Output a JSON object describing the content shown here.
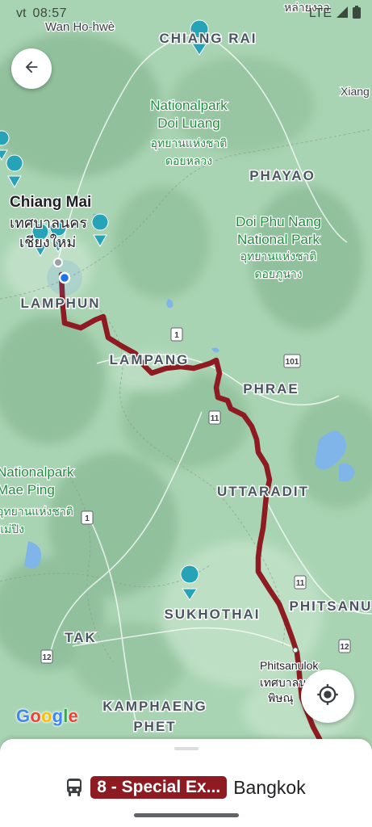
{
  "status_bar": {
    "time": "08:57",
    "carrier_fragment": "vt",
    "network": "LTE",
    "icons": [
      "cell-signal-icon",
      "battery-icon"
    ]
  },
  "map": {
    "cities": [
      {
        "name": "CHIANG RAI"
      },
      {
        "name": "PHAYAO"
      },
      {
        "name": "LAMPHUN"
      },
      {
        "name": "LAMPANG"
      },
      {
        "name": "PHRAE"
      },
      {
        "name": "UTTARADIT"
      },
      {
        "name": "SUKHOTHAI"
      },
      {
        "name": "TAK"
      },
      {
        "name": "KAMPHAENG"
      },
      {
        "name": "PHET"
      },
      {
        "name": "PHITSANU"
      }
    ],
    "places": [
      {
        "name": "Wan Ho-hwè"
      },
      {
        "name": "หล่ายงาว"
      },
      {
        "name": "Xiang"
      },
      {
        "name": "Chiang Mai"
      },
      {
        "name": "เทศบาลนคร"
      },
      {
        "name": "เชียงใหม่"
      },
      {
        "name": "Phitsanulok"
      },
      {
        "name": "เทศบาลน"
      },
      {
        "name": "พิษณุ"
      }
    ],
    "parks": [
      {
        "lines": [
          "Nationalpark",
          "Doi Luang"
        ]
      },
      {
        "lines": [
          "อุทยานแห่งชาติ",
          "ดอยหลวง"
        ]
      },
      {
        "lines": [
          "Doi Phu Nang",
          "National Park"
        ]
      },
      {
        "lines": [
          "อุทยานแห่งชาติ",
          "ดอยภูนาง"
        ]
      },
      {
        "lines": [
          "Nationalpark",
          "Mae Ping"
        ]
      },
      {
        "lines": [
          "อุทยานแห่งชาติ",
          "แม่ปิง"
        ]
      }
    ],
    "highway_shields": [
      "1",
      "101",
      "11",
      "1",
      "11",
      "12",
      "12"
    ],
    "route_color": "#8e1b22",
    "pin_color": "#26a3b7",
    "land_color": "#a9d4b3"
  },
  "controls": {
    "back_icon": "arrow-back-icon",
    "locate_icon": "my-location-icon"
  },
  "google_logo": {
    "letters": [
      "G",
      "o",
      "o",
      "g",
      "l",
      "e"
    ],
    "colors": [
      "#4285F4",
      "#EA4335",
      "#FBBC05",
      "#4285F4",
      "#34A853",
      "#EA4335"
    ]
  },
  "bottom_sheet": {
    "transit_icon": "bus-icon",
    "route_name": "8 - Special Ex...",
    "destination": "Bangkok"
  }
}
